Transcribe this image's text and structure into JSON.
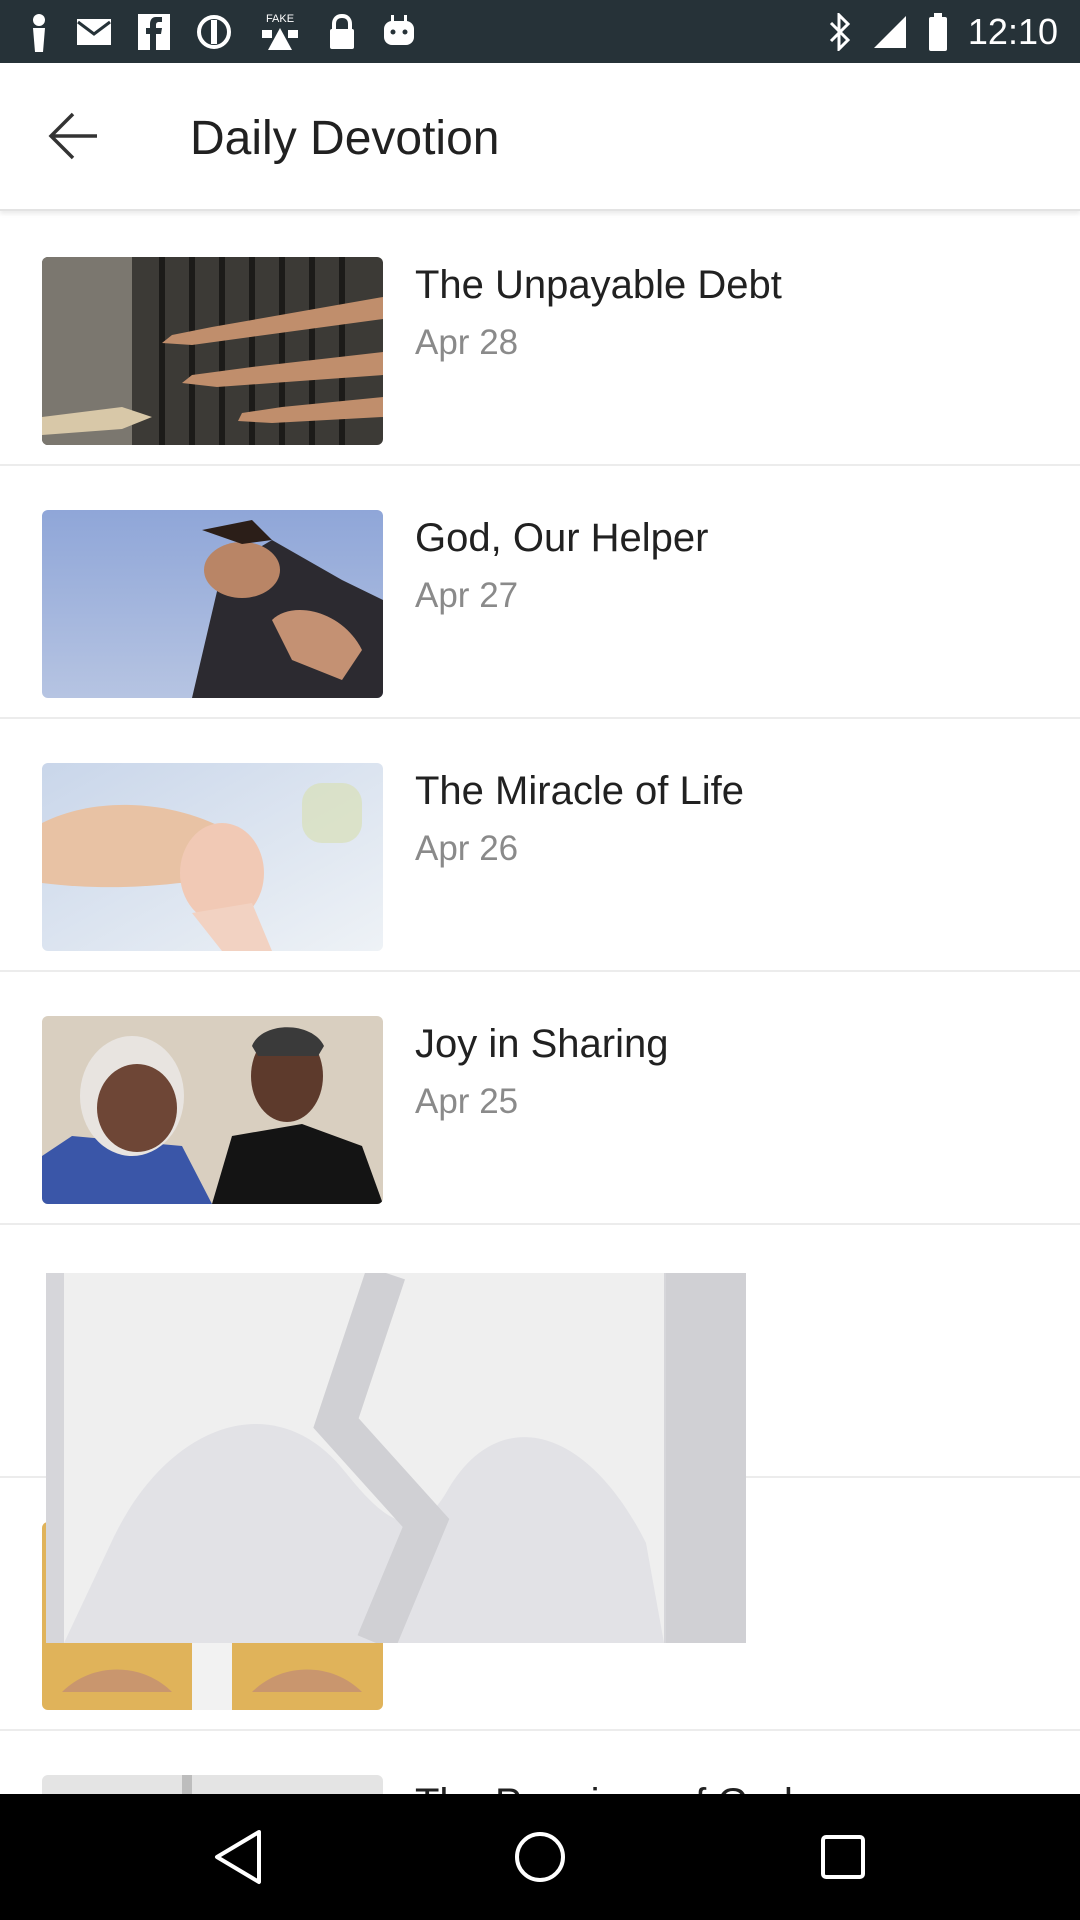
{
  "status_bar": {
    "time": "12:10",
    "icons": [
      "notification-icon",
      "mail-icon",
      "facebook-icon",
      "blocked-icon",
      "fake-gps-icon",
      "lock-icon",
      "android-icon",
      "bluetooth-icon",
      "signal-icon",
      "battery-icon"
    ]
  },
  "header": {
    "title": "Daily Devotion",
    "back_icon": "arrow-back-icon"
  },
  "devotions": [
    {
      "title": "The Unpayable Debt",
      "date": "Apr 28",
      "image": "hands-through-bars"
    },
    {
      "title": "God, Our Helper",
      "date": "Apr 27",
      "image": "man-reaching-sky"
    },
    {
      "title": "The Miracle of Life",
      "date": "Apr 26",
      "image": "baby-holding-hand"
    },
    {
      "title": "Joy in Sharing",
      "date": "Apr 25",
      "image": "two-women-smiling"
    }
  ],
  "partial_last_title": "The Promises of God",
  "nav_bar": {
    "buttons": [
      "back-triangle-icon",
      "home-circle-icon",
      "recents-square-icon"
    ]
  },
  "colors": {
    "status_bar": "#263238",
    "title_text": "#212121",
    "date_text": "#8a8a8a",
    "divider": "#ececec"
  }
}
